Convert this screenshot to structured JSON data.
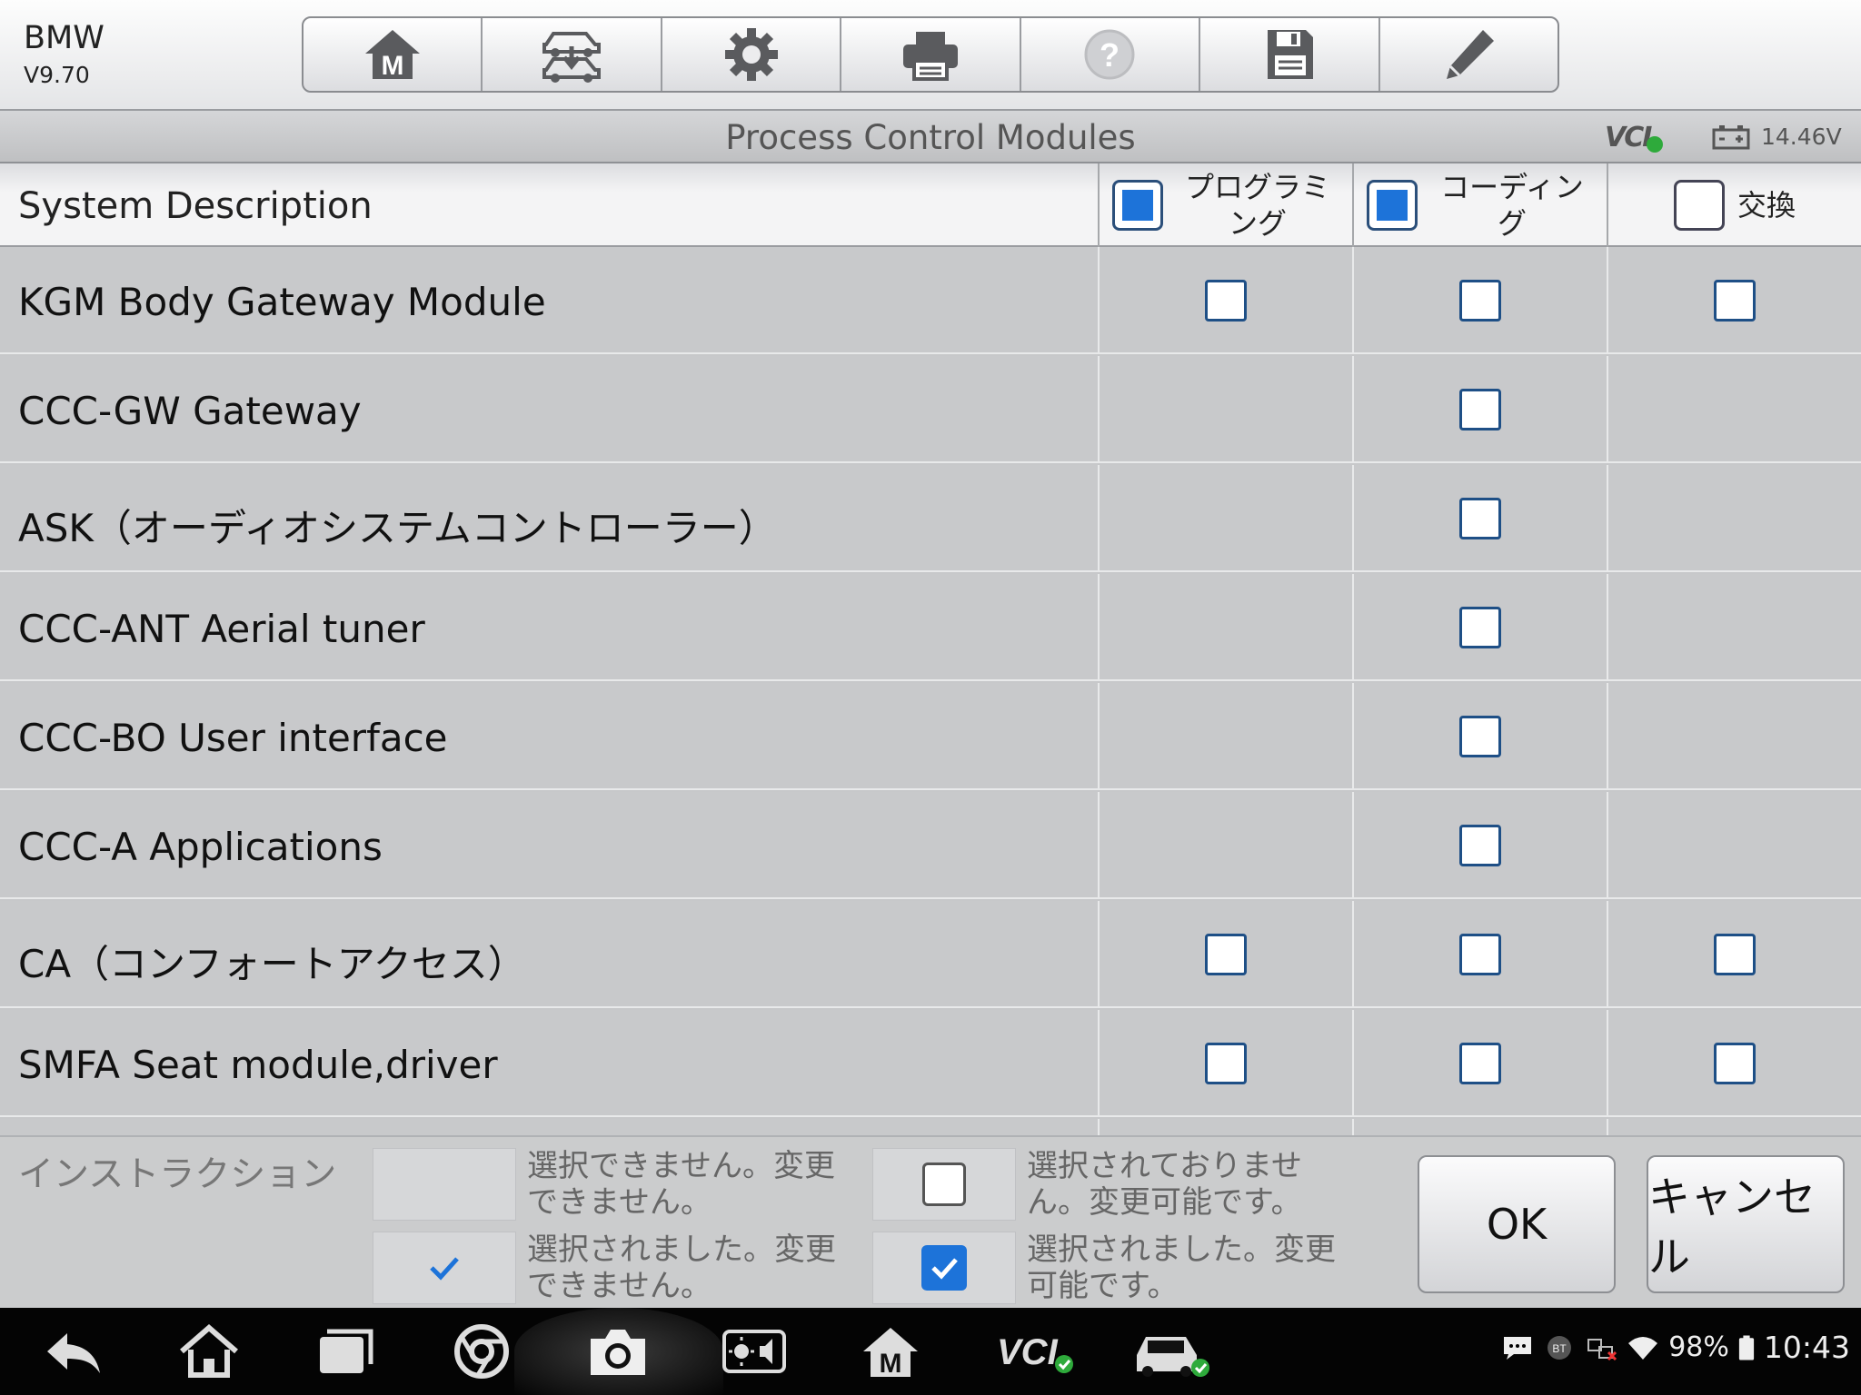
{
  "header": {
    "make": "BMW",
    "version": "V9.70",
    "toolbar": [
      "home-icon",
      "vehicle-swap-icon",
      "settings-gear-icon",
      "printer-icon",
      "help-icon",
      "save-disk-icon",
      "edit-pencil-icon"
    ]
  },
  "titlebar": {
    "title": "Process Control Modules",
    "vci": "VCI",
    "voltage": "14.46V"
  },
  "table": {
    "desc_header": "System Description",
    "columns": [
      {
        "label": "プログラミング",
        "checked": true
      },
      {
        "label": "コーディング",
        "checked": true
      },
      {
        "label": "交換",
        "checked": false
      }
    ],
    "rows": [
      {
        "name": "KGM Body Gateway Module",
        "cells": [
          true,
          true,
          true
        ]
      },
      {
        "name": "CCC-GW Gateway",
        "cells": [
          false,
          true,
          false
        ]
      },
      {
        "name": "ASK（オーディオシステムコントローラー）",
        "cells": [
          false,
          true,
          false
        ]
      },
      {
        "name": "CCC-ANT Aerial tuner",
        "cells": [
          false,
          true,
          false
        ]
      },
      {
        "name": "CCC-BO User interface",
        "cells": [
          false,
          true,
          false
        ]
      },
      {
        "name": "CCC-A Applications",
        "cells": [
          false,
          true,
          false
        ]
      },
      {
        "name": "CA（コンフォートアクセス）",
        "cells": [
          true,
          true,
          true
        ]
      },
      {
        "name": "SMFA Seat module,driver",
        "cells": [
          true,
          true,
          true
        ]
      }
    ]
  },
  "footer": {
    "instruction": "インストラクション",
    "legend": {
      "unselectable": "選択できません。変更できません。",
      "selected_locked": "選択されました。変更できません。",
      "unselected_changeable": "選択されておりません。変更可能です。",
      "selected_changeable": "選択されました。変更可能です。"
    },
    "ok": "OK",
    "cancel": "キャンセル"
  },
  "statusbar": {
    "battery": "98%",
    "time": "10:43",
    "bt": "BT"
  },
  "colors": {
    "accent": "#1d73d9",
    "checkbox_border": "#1e4f86",
    "row_bg": "#c8c9cb",
    "vci_ok": "#2eaa3b"
  }
}
